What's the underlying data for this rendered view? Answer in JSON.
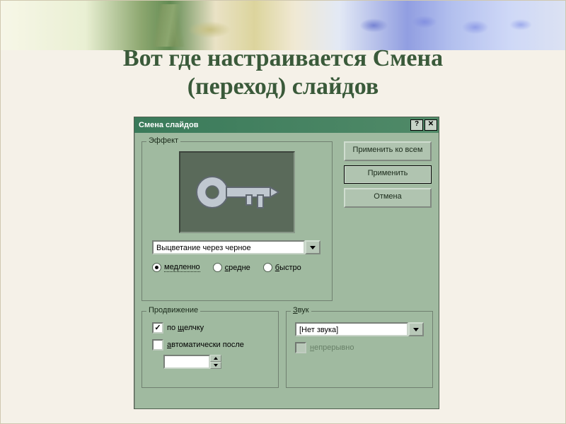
{
  "slide": {
    "title_line1": "Вот где настраивается Смена",
    "title_line2": "(переход) слайдов"
  },
  "dialog": {
    "title": "Смена слайдов",
    "help_symbol": "?",
    "close_symbol": "✕",
    "effect": {
      "group_label": "Эффект",
      "selected": "Выцветание через черное",
      "speed": {
        "slow": "медленно",
        "medium": "средне",
        "fast": "быстро",
        "selected": "slow"
      }
    },
    "buttons": {
      "apply_all": "Применить ко всем",
      "apply": "Применить",
      "cancel": "Отмена"
    },
    "advance": {
      "group_label": "Продвижение",
      "on_click_prefix": "по ",
      "on_click_u": "щ",
      "on_click_suffix": "елчку",
      "on_click_checked": true,
      "auto_u": "а",
      "auto_suffix": "втоматически после",
      "auto_checked": false,
      "time_value": ""
    },
    "sound": {
      "group_label_u": "З",
      "group_label_suffix": "вук",
      "selected": "[Нет звука]",
      "loop_u": "н",
      "loop_suffix": "епрерывно",
      "loop_checked": false
    }
  }
}
